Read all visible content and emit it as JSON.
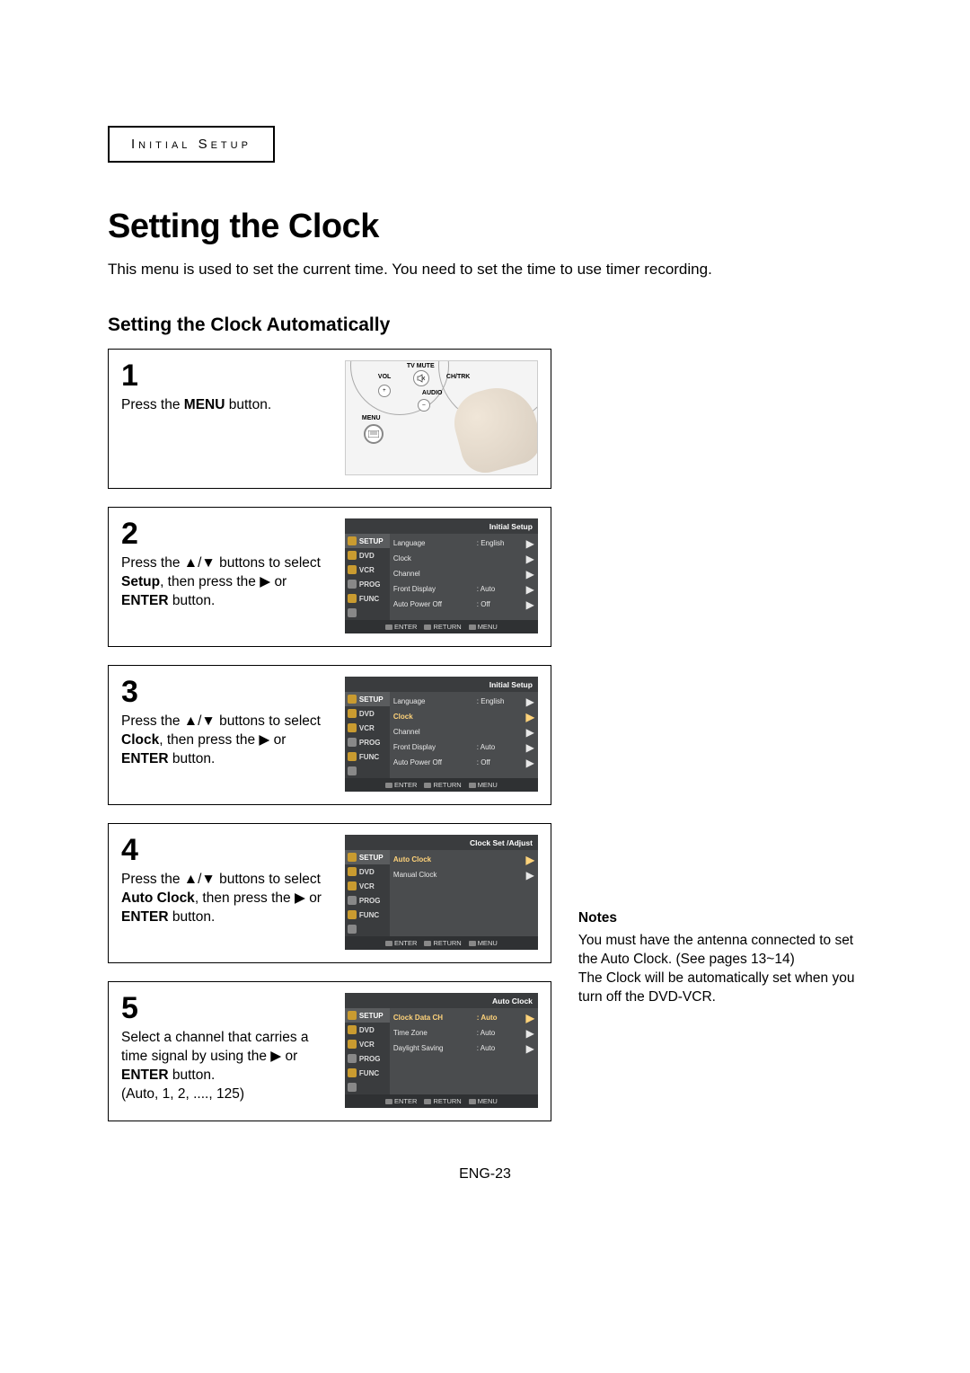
{
  "breadcrumb": "Initial Setup",
  "title": "Setting the Clock",
  "intro": "This menu is used to set the current time. You need to set the time to use timer recording.",
  "subtitle": "Setting the Clock Automatically",
  "steps": {
    "s1": {
      "num": "1",
      "text_a": "Press the ",
      "bold_a": "MENU",
      "text_b": " button."
    },
    "s2": {
      "num": "2",
      "text_a": "Press the ▲/▼ buttons to select ",
      "bold_a": "Setup",
      "text_b": ", then press the ▶ or ",
      "bold_b": "ENTER",
      "text_c": " button."
    },
    "s3": {
      "num": "3",
      "text_a": "Press the ▲/▼ buttons to select ",
      "bold_a": "Clock",
      "text_b": ", then press the ▶ or ",
      "bold_b": "ENTER",
      "text_c": " button."
    },
    "s4": {
      "num": "4",
      "text_a": "Press the ▲/▼ buttons to select ",
      "bold_a": "Auto Clock",
      "text_b": ", then press the ▶ or ",
      "bold_b": "ENTER",
      "text_c": " button."
    },
    "s5": {
      "num": "5",
      "text_a": "Select a channel that carries a time signal by using the ▶ or ",
      "bold_a": "ENTER",
      "text_b": " button.",
      "text_c": "(Auto, 1, 2, ...., 125)"
    }
  },
  "remote": {
    "tvmute": "TV MUTE",
    "vol": "VOL",
    "chtrk": "CH/TRK",
    "audio": "AUDIO",
    "menu": "MENU",
    "plus": "+",
    "minus": "–"
  },
  "osd_tabs": {
    "setup": "SETUP",
    "dvd": "DVD",
    "vcr": "VCR",
    "prog": "PROG",
    "func": "FUNC"
  },
  "osd2": {
    "title": "Initial Setup",
    "rows": [
      {
        "label": "Language",
        "val": ": English"
      },
      {
        "label": "Clock",
        "val": ""
      },
      {
        "label": "Channel",
        "val": ""
      },
      {
        "label": "Front Display",
        "val": ": Auto"
      },
      {
        "label": "Auto Power Off",
        "val": ": Off"
      }
    ]
  },
  "osd3": {
    "title": "Initial Setup",
    "rows": [
      {
        "label": "Language",
        "val": ": English"
      },
      {
        "label": "Clock",
        "val": "",
        "hl": true
      },
      {
        "label": "Channel",
        "val": ""
      },
      {
        "label": "Front Display",
        "val": ": Auto"
      },
      {
        "label": "Auto Power Off",
        "val": ": Off"
      }
    ]
  },
  "osd4": {
    "title": "Clock Set /Adjust",
    "rows": [
      {
        "label": "Auto Clock",
        "val": "",
        "hl": true
      },
      {
        "label": "Manual Clock",
        "val": ""
      }
    ]
  },
  "osd5": {
    "title": "Auto Clock",
    "rows": [
      {
        "label": "Clock Data CH",
        "val": ": Auto",
        "hl": true
      },
      {
        "label": "Time Zone",
        "val": ": Auto"
      },
      {
        "label": "Daylight Saving",
        "val": ": Auto"
      }
    ]
  },
  "osd_footer": {
    "enter": "ENTER",
    "return": "RETURN",
    "menu": "MENU"
  },
  "notes": {
    "heading": "Notes",
    "p1": "You must have the antenna connected to set the Auto Clock. (See pages 13~14)",
    "p2": "The Clock will be automatically set when you turn off the DVD-VCR."
  },
  "pagenum": "ENG-23"
}
